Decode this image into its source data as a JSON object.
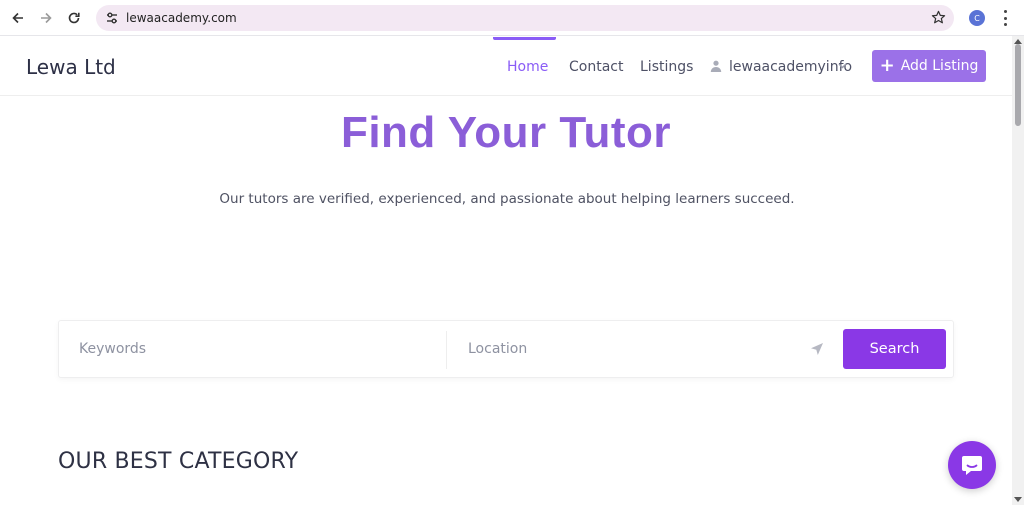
{
  "browser": {
    "url": "lewaacademy.com",
    "profile_initial": "C"
  },
  "header": {
    "logo": "Lewa Ltd",
    "nav": [
      {
        "label": "Home",
        "active": true
      },
      {
        "label": "Contact",
        "active": false
      },
      {
        "label": "Listings",
        "active": false
      }
    ],
    "user": "lewaacademyinfo",
    "add_listing": "Add Listing",
    "add_icon": "+"
  },
  "hero": {
    "title": "Find Your Tutor",
    "subtitle": "Our tutors are verified, experienced, and passionate about helping learners succeed."
  },
  "search": {
    "keywords_placeholder": "Keywords",
    "location_placeholder": "Location",
    "button": "Search"
  },
  "category": {
    "title": "OUR BEST CATEGORY"
  },
  "colors": {
    "accent": "#8a5cf6",
    "title": "#8b5ed8",
    "button": "#8a38e6",
    "add_button": "#9b71e8"
  }
}
